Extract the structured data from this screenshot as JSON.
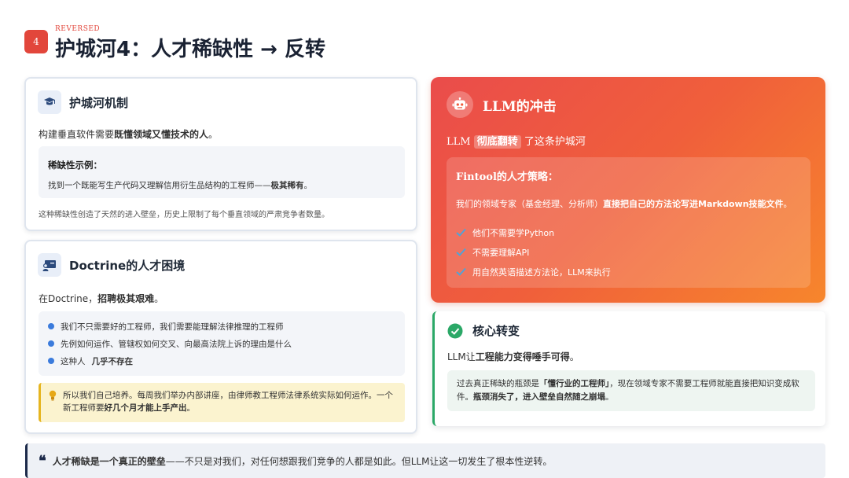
{
  "header": {
    "slide_number": "4",
    "tag": "REVERSED",
    "title": "护城河4：人才稀缺性 → 反转"
  },
  "moat_card": {
    "title": "护城河机制",
    "lead_pre": "构建垂直软件需要",
    "lead_bold": "既懂领域又懂技术的人",
    "lead_post": "。",
    "example_title": "稀缺性示例：",
    "example_pre": "找到一个既能写生产代码又理解信用衍生品结构的工程师——",
    "example_bold": "极其稀有",
    "example_post": "。",
    "note": "这种稀缺性创造了天然的进入壁垒，历史上限制了每个垂直领域的严肃竞争者数量。"
  },
  "doctrine_card": {
    "title": "Doctrine的人才困境",
    "lead_pre": "在Doctrine，",
    "lead_bold": "招聘极其艰难",
    "lead_post": "。",
    "bullets": [
      "我们不只需要好的工程师，我们需要能理解法律推理的工程师",
      "先例如何运作、管辖权如何交叉、向最高法院上诉的理由是什么"
    ],
    "bullet3_pre": "这种人",
    "bullet3_bold": "几乎不存在",
    "warn_pre": "所以我们自己培养。每周我们举办内部讲座，由律师教工程师法律系统实际如何运作。一个新工程师要",
    "warn_bold": "好几个月才能上手产出",
    "warn_post": "。"
  },
  "llm_card": {
    "title": "LLM的冲击",
    "lead_pre": "LLM",
    "lead_highlight": "彻底翻转",
    "lead_post": "了这条护城河",
    "strategy_title": "Fintool的人才策略：",
    "strategy_pre": "我们的领域专家（基金经理、分析师）",
    "strategy_bold": "直接把自己的方法论写进Markdown技能文件",
    "strategy_post": "。",
    "checks": [
      "他们不需要学Python",
      "不需要理解API",
      "用自然英语描述方法论，LLM来执行"
    ]
  },
  "shift_card": {
    "title": "核心转变",
    "lead_pre": "LLM让",
    "lead_bold": "工程能力变得唾手可得",
    "lead_post": "。",
    "body_pre": "过去真正稀缺的瓶颈是",
    "body_bold1": "「懂行业的工程师」",
    "body_mid": "，现在领域专家不需要工程师就能直接把知识变成软件。",
    "body_bold2": "瓶颈消失了，进入壁垒自然随之崩塌",
    "body_post": "。"
  },
  "quote": {
    "mark": "❝",
    "bold": "人才稀缺是一个真正的壁垒",
    "rest": "——不只是对我们，对任何想跟我们竞争的人都是如此。但LLM让这一切发生了根本性逆转。"
  },
  "colors": {
    "accent_red": "#e2463b",
    "llm_gradient_start": "#ea4c4b",
    "llm_gradient_end": "#f7862c",
    "success_green": "#2ba867",
    "bullet_blue": "#3b7bdc",
    "warning_yellow": "#e6b520"
  },
  "icons": {
    "moat": "graduate-icon",
    "doctrine": "presenter-icon",
    "llm": "robot-icon",
    "shift": "check-circle-icon",
    "warning": "lightbulb-icon"
  }
}
